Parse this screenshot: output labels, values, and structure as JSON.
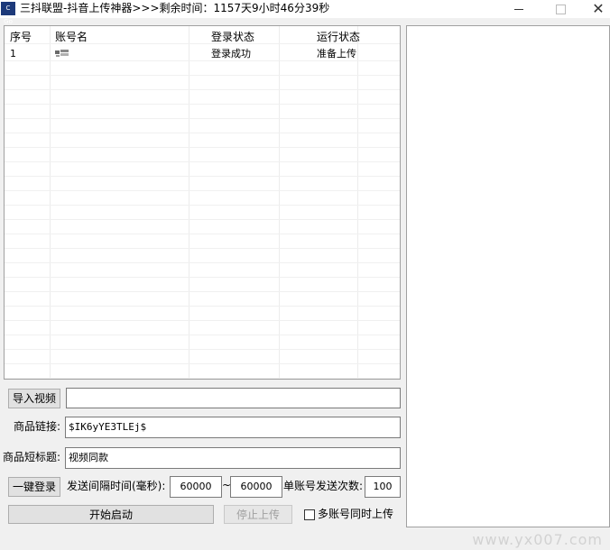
{
  "window": {
    "icon_text": "C Go",
    "title": "三抖联盟-抖音上传神器>>>剩余时间：1157天9小时46分39秒",
    "min_icon": "minimize-icon",
    "max_icon": "maximize-icon",
    "close_icon": "close-icon",
    "close_glyph": "✕"
  },
  "table": {
    "columns": [
      "序号",
      "账号名",
      "登录状态",
      "运行状态"
    ],
    "rows": [
      {
        "index": "1",
        "account_icon": "account-avatar-icon",
        "login_status": "登录成功",
        "run_status": "准备上传"
      }
    ]
  },
  "controls": {
    "import_video_button": "导入视频",
    "import_video_value": "",
    "product_link_label": "商品链接:",
    "product_link_value": "$IK6yYE3TLEj$",
    "product_title_label": "商品短标题:",
    "product_title_value": "视频同款",
    "one_click_login_button": "一键登录",
    "interval_label": "发送间隔时间(毫秒):",
    "interval_min": "60000",
    "interval_separator": "~",
    "interval_max": "60000",
    "send_count_label": "单账号发送次数:",
    "send_count_value": "100",
    "start_button": "开始启动",
    "stop_button": "停止上传",
    "multi_upload_label": "多账号同时上传",
    "multi_upload_checked": false
  },
  "watermark": "www.yx007.com"
}
